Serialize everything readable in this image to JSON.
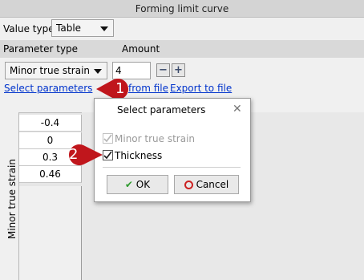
{
  "panel": {
    "title": "Forming limit curve"
  },
  "value_type": {
    "label": "Value type",
    "selected": "Table"
  },
  "params_header": {
    "parameter_type": "Parameter type",
    "amount": "Amount"
  },
  "parameter_select": {
    "selected": "Minor true strain"
  },
  "amount": {
    "value": "4",
    "minus": "−",
    "plus": "+"
  },
  "links": {
    "select_parameters": "Select parameters",
    "import": "from file",
    "export": "Export to file"
  },
  "table": {
    "axis_label": "Minor true strain",
    "rows": [
      "-0.4",
      "0",
      "0.3",
      "0.46"
    ]
  },
  "badges": {
    "one": "1",
    "two": "2"
  },
  "dialog": {
    "title": "Select parameters",
    "close": "✕",
    "options": [
      {
        "label": "Minor true strain",
        "checked": true,
        "disabled": true
      },
      {
        "label": "Thickness",
        "checked": true,
        "disabled": false
      }
    ],
    "ok": "OK",
    "cancel": "Cancel"
  },
  "colors": {
    "badge": "#c0161c",
    "link": "#0033cc",
    "ok_check": "#2e9a2e",
    "cancel_icon": "#cc2222"
  }
}
